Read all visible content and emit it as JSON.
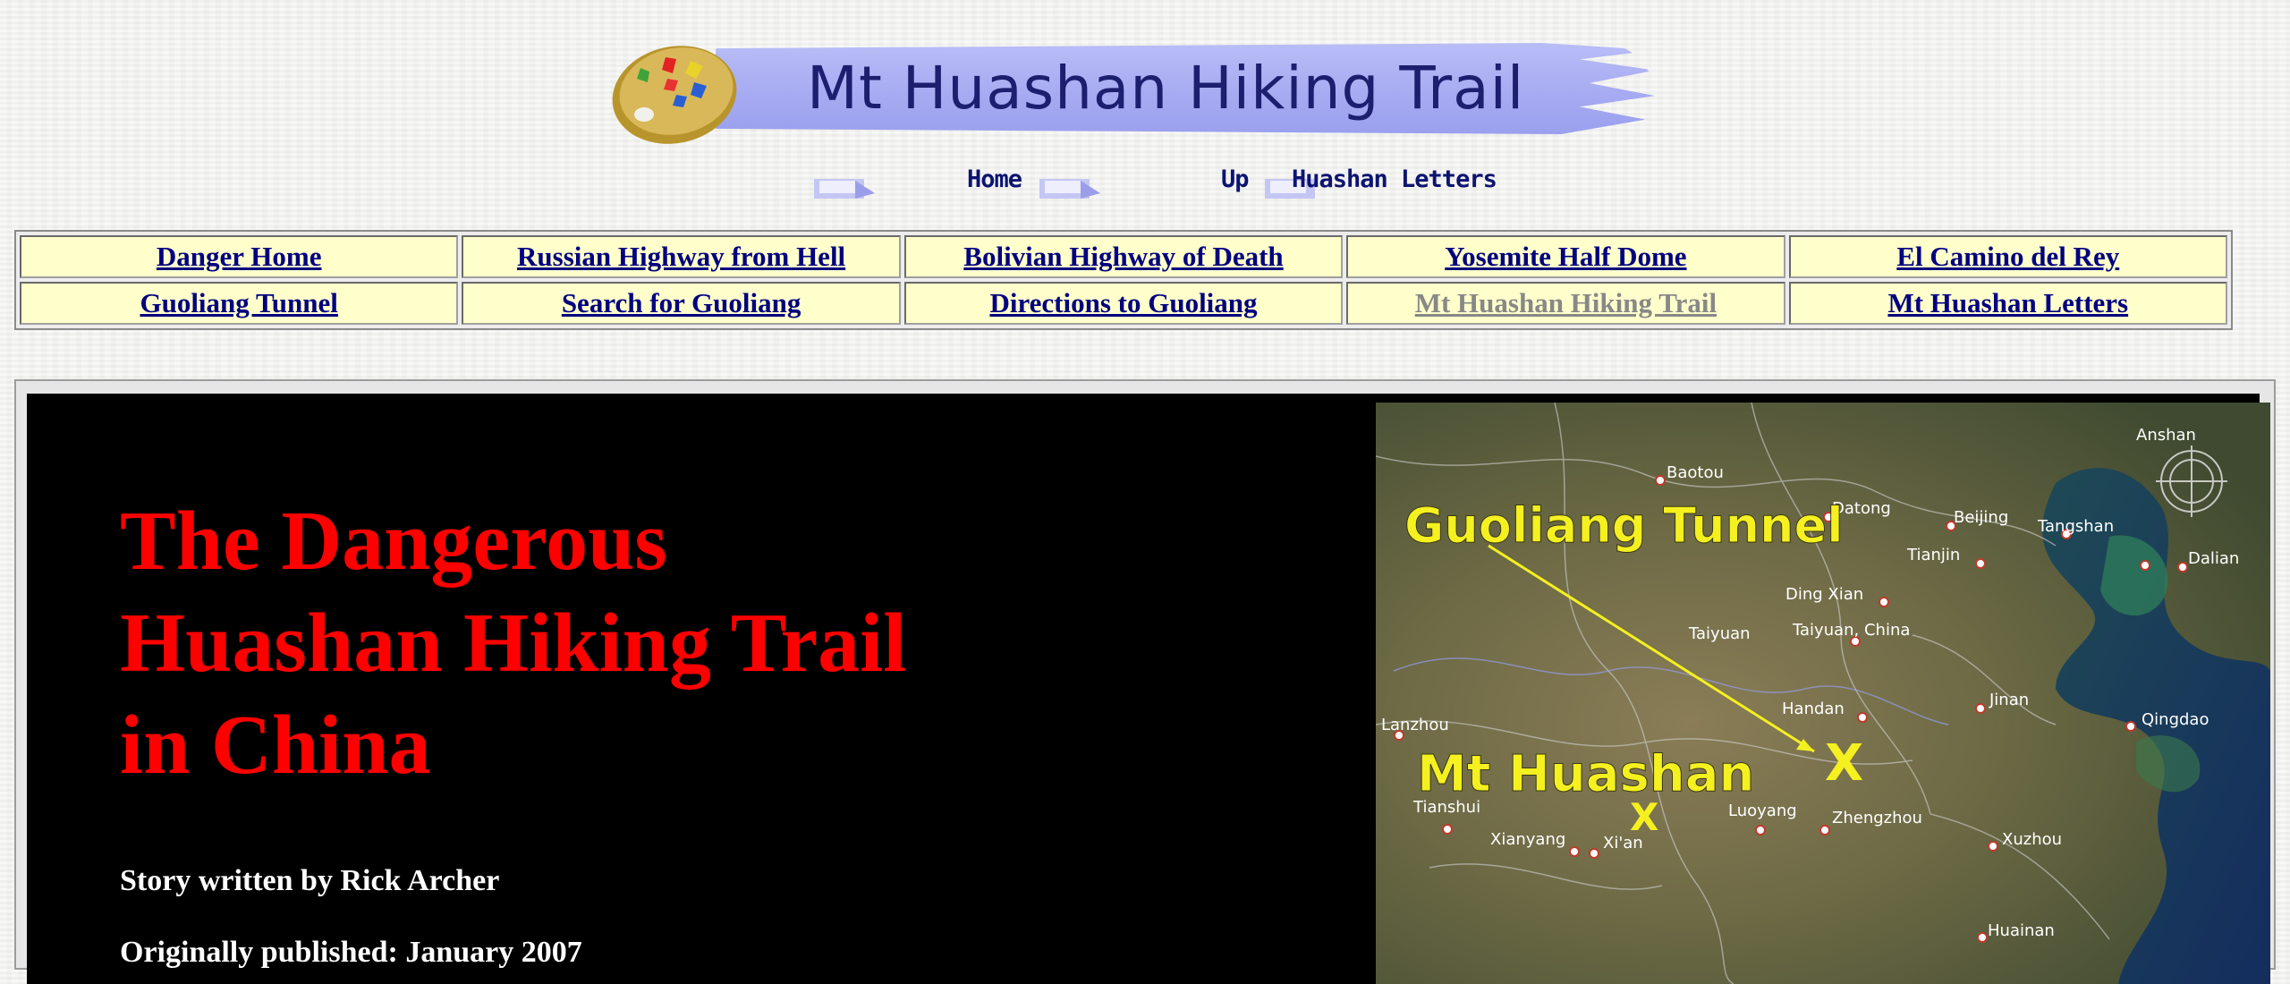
{
  "banner": {
    "title": "Mt Huashan Hiking Trail"
  },
  "nav": {
    "home_label": "Home",
    "up_label": "Up",
    "next_label": "Huashan Letters"
  },
  "links": {
    "row1": [
      "Danger Home",
      "Russian Highway from Hell",
      "Bolivian Highway of Death",
      "Yosemite Half Dome",
      "El Camino del Rey"
    ],
    "row2": [
      "Guoliang Tunnel",
      "Search for Guoliang",
      "Directions to Guoliang",
      "Mt Huashan Hiking Trail",
      "Mt Huashan Letters"
    ],
    "current": "Mt Huashan Hiking Trail"
  },
  "article": {
    "headline_line1": "The Dangerous",
    "headline_line2": "Huashan Hiking Trail",
    "headline_line3": "in China",
    "byline": "Story written by Rick Archer",
    "published": "Originally published: January 2007"
  },
  "map": {
    "label_tunnel": "Guoliang Tunnel",
    "label_huashan": "Mt Huashan",
    "marker": "X",
    "cities": [
      "Baotou",
      "Datong",
      "Beijing",
      "Tangshan",
      "Anshan",
      "Dalian",
      "Tianjin",
      "Ding Xian",
      "Taiyuan",
      "Taiyuan, China",
      "Handan",
      "Jinan",
      "Qingdao",
      "Lanzhou",
      "Tianshui",
      "Luoyang",
      "Zhengzhou",
      "Xianyang",
      "Xi'an",
      "Xuzhou",
      "Huainan"
    ]
  },
  "colors": {
    "headline": "#ff0000",
    "link": "#000080",
    "link_current": "#888888",
    "cell_bg": "#ffffcc",
    "map_label": "#f5f020"
  }
}
